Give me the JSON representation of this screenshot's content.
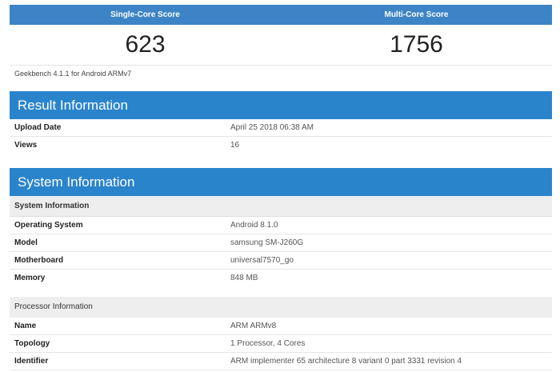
{
  "scores": {
    "single_label": "Single-Core Score",
    "multi_label": "Multi-Core Score",
    "single_value": "623",
    "multi_value": "1756",
    "version": "Geekbench 4.1.1 for Android ARMv7"
  },
  "result_info": {
    "title": "Result Information",
    "rows": [
      {
        "key": "Upload Date",
        "value": "April 25 2018 06:38 AM"
      },
      {
        "key": "Views",
        "value": "16"
      }
    ]
  },
  "system_info": {
    "title": "System Information",
    "subheader": "System Information",
    "rows": [
      {
        "key": "Operating System",
        "value": "Android 8.1.0"
      },
      {
        "key": "Model",
        "value": "samsung SM-J260G"
      },
      {
        "key": "Motherboard",
        "value": "universal7570_go"
      },
      {
        "key": "Memory",
        "value": "848 MB"
      }
    ]
  },
  "processor_info": {
    "subheader": "Processor Information",
    "rows": [
      {
        "key": "Name",
        "value": "ARM ARMv8"
      },
      {
        "key": "Topology",
        "value": "1 Processor, 4 Cores"
      },
      {
        "key": "Identifier",
        "value": "ARM implementer 65 architecture 8 variant 0 part 3331 revision 4"
      }
    ]
  }
}
